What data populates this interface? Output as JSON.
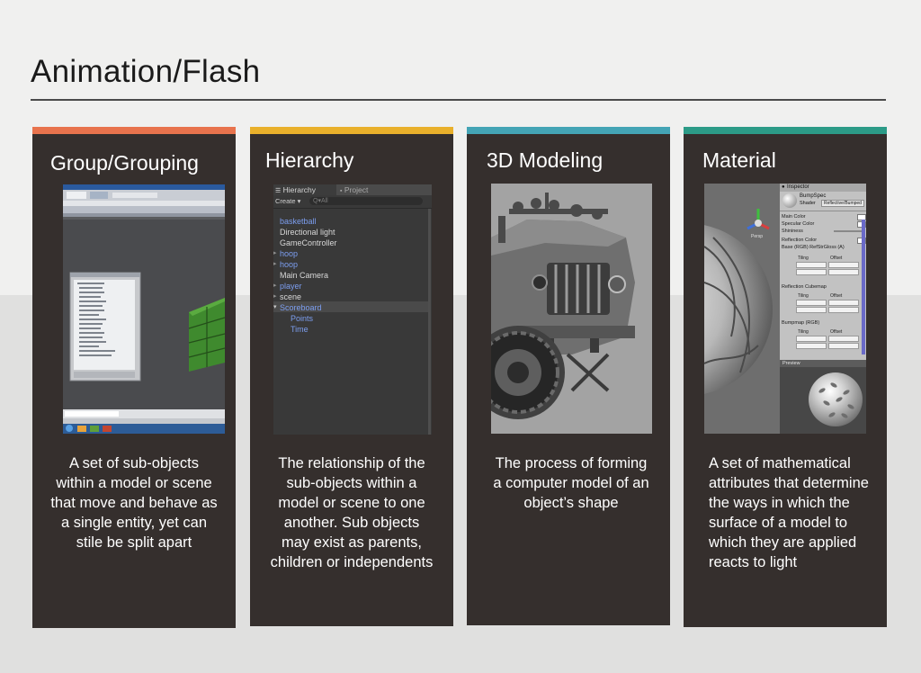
{
  "slide": {
    "title": "Animation/Flash"
  },
  "colors": {
    "card_background": "#352f2d",
    "bar_group": "#e8734d",
    "bar_hierarchy": "#e9b02b",
    "bar_modeling": "#44a4b5",
    "bar_material": "#2c9b87"
  },
  "cards": [
    {
      "heading": "Group/Grouping",
      "description": "A set of sub-objects within a model or scene that move and behave as a single entity, yet can stile be split apart",
      "image_icon": "software-screenshot"
    },
    {
      "heading": "Hierarchy",
      "description": "The relationship of the sub-objects within a model or scene to one another. Sub objects may exist as parents, children or independents",
      "image": {
        "tabs": [
          "Hierarchy",
          "Project"
        ],
        "create_label": "Create",
        "search_placeholder": "Q▾All",
        "items": [
          "basketball",
          "Directional light",
          "GameController",
          "hoop",
          "hoop",
          "Main Camera",
          "player",
          "scene",
          "Scoreboard",
          "Points",
          "Time"
        ]
      }
    },
    {
      "heading": "3D Modeling",
      "description": "The process of forming a computer model of an object’s shape",
      "image_icon": "vehicle-model-render"
    },
    {
      "heading": "Material",
      "description": "A set of mathematical attributes that determine the ways in which the surface of a model to which they are applied reacts to light",
      "image": {
        "inspector_title": "Inspector",
        "material_name": "BumpSpec",
        "shader_label": "Shader",
        "shader_value": "Reflective/Bumped",
        "persp_label": "Persp",
        "properties": [
          "Main Color",
          "Specular Color",
          "Shininess",
          "Reflection Color",
          "Base (RGB) RefStrGloss (A)"
        ],
        "cubemap_label": "Reflection Cubemap",
        "bumpmap_label": "Bumpmap (RGB)",
        "tiling_label": "Tiling",
        "offset_label": "Offset",
        "preview_label": "Preview"
      }
    }
  ]
}
